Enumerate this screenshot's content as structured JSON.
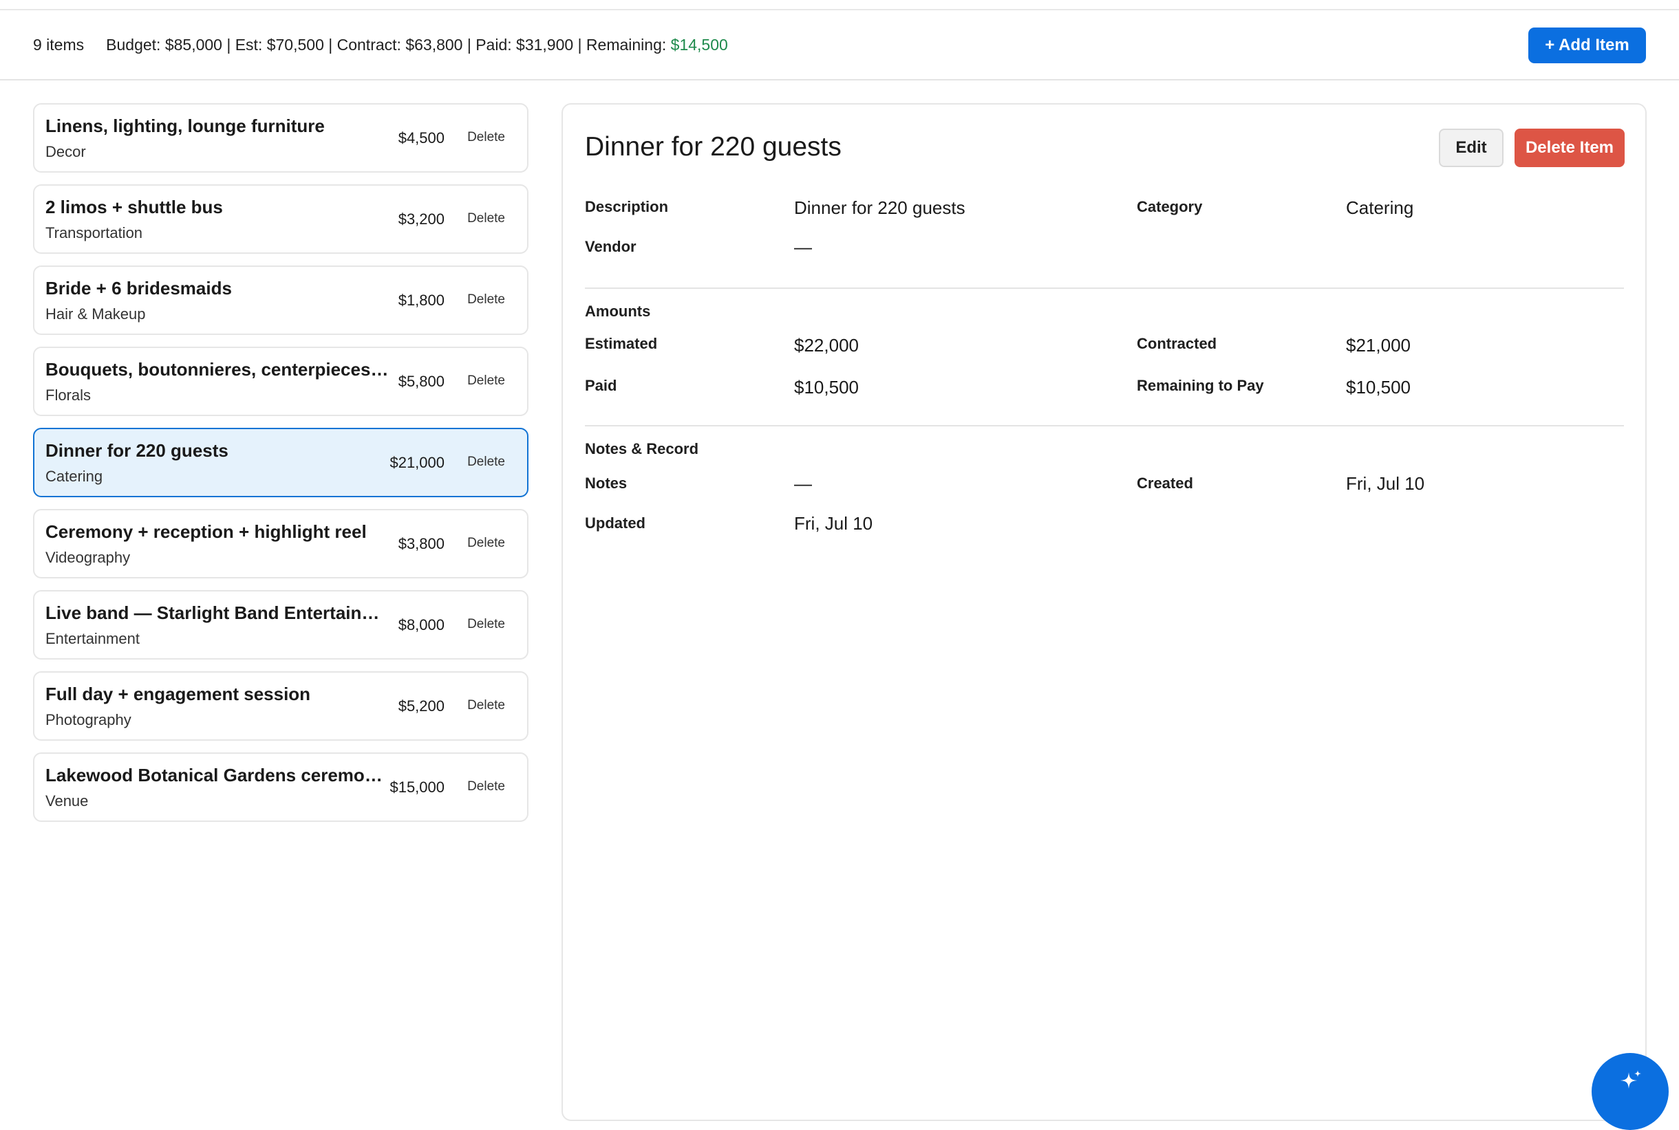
{
  "summary": {
    "count": "9 items",
    "totals": "Budget: $85,000 | Est: $70,500 | Contract: $63,800 | Paid: $31,900 | Remaining: ",
    "remaining": "$14,500",
    "add_label": "+ Add Item"
  },
  "items": [
    {
      "title": "Linens, lighting, lounge furniture",
      "category": "Decor",
      "amount": "$4,500",
      "delete": "Delete"
    },
    {
      "title": "2 limos + shuttle bus",
      "category": "Transportation",
      "amount": "$3,200",
      "delete": "Delete"
    },
    {
      "title": "Bride + 6 bridesmaids",
      "category": "Hair & Makeup",
      "amount": "$1,800",
      "delete": "Delete"
    },
    {
      "title": "Bouquets, boutonnieres, centerpieces, a...",
      "category": "Florals",
      "amount": "$5,800",
      "delete": "Delete"
    },
    {
      "title": "Dinner for 220 guests",
      "category": "Catering",
      "amount": "$21,000",
      "delete": "Delete",
      "selected": true
    },
    {
      "title": "Ceremony + reception + highlight reel",
      "category": "Videography",
      "amount": "$3,800",
      "delete": "Delete"
    },
    {
      "title": "Live band — Starlight Band Entertainment",
      "category": "Entertainment",
      "amount": "$8,000",
      "delete": "Delete"
    },
    {
      "title": "Full day + engagement session",
      "category": "Photography",
      "amount": "$5,200",
      "delete": "Delete"
    },
    {
      "title": "Lakewood Botanical Gardens ceremony...",
      "category": "Venue",
      "amount": "$15,000",
      "delete": "Delete"
    }
  ],
  "detail": {
    "title": "Dinner for 220 guests",
    "edit_label": "Edit",
    "delete_label": "Delete Item",
    "description_label": "Description",
    "description": "Dinner for 220 guests",
    "category_label": "Category",
    "category": "Catering",
    "vendor_label": "Vendor",
    "vendor": "—",
    "amounts_heading": "Amounts",
    "estimated_label": "Estimated",
    "estimated": "$22,000",
    "contracted_label": "Contracted",
    "contracted": "$21,000",
    "paid_label": "Paid",
    "paid": "$10,500",
    "remaining_label": "Remaining to Pay",
    "remaining": "$10,500",
    "notes_heading": "Notes & Record",
    "notes_label": "Notes",
    "notes": "—",
    "created_label": "Created",
    "created": "Fri, Jul 10",
    "updated_label": "Updated",
    "updated": "Fri, Jul 10"
  },
  "fab_icon": "sparkle-icon",
  "colors": {
    "accent": "#0b6fe0",
    "danger": "#dd5545",
    "positive": "#1e8a4c",
    "selected_bg": "#e5f2fc"
  }
}
